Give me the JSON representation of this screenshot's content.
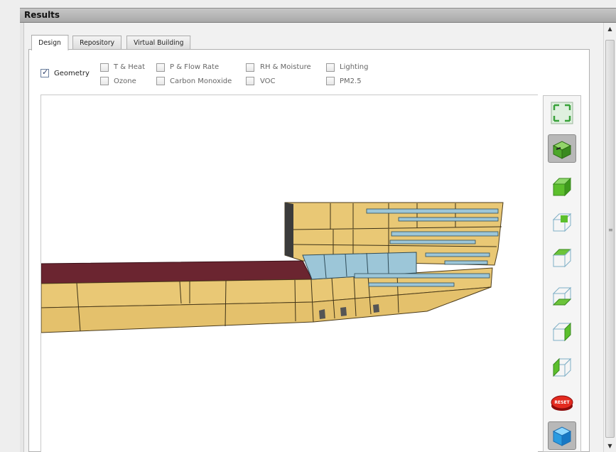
{
  "panel": {
    "title": "Results"
  },
  "tabs": [
    {
      "label": "Design",
      "active": true
    },
    {
      "label": "Repository",
      "active": false
    },
    {
      "label": "Virtual Building",
      "active": false
    }
  ],
  "layers": [
    {
      "label": "Geometry",
      "checked": true
    },
    {
      "label": "T & Heat",
      "checked": false
    },
    {
      "label": "P & Flow Rate",
      "checked": false
    },
    {
      "label": "RH & Moisture",
      "checked": false
    },
    {
      "label": "Lighting",
      "checked": false
    },
    {
      "label": "Ozone",
      "checked": false
    },
    {
      "label": "Carbon Monoxide",
      "checked": false
    },
    {
      "label": "VOC",
      "checked": false
    },
    {
      "label": "PM2.5",
      "checked": false
    }
  ],
  "toolbar": {
    "buttons": [
      {
        "icon": "fit-view-icon"
      },
      {
        "icon": "orbit-view-icon",
        "selected": true
      },
      {
        "icon": "iso-view-icon"
      },
      {
        "icon": "top-view-icon"
      },
      {
        "icon": "bottom-view-icon"
      },
      {
        "icon": "front-view-icon"
      },
      {
        "icon": "back-view-icon"
      },
      {
        "icon": "left-view-icon"
      },
      {
        "icon": "reset-button-icon",
        "label": "RESET"
      },
      {
        "icon": "solid-cube-icon"
      }
    ]
  },
  "colors": {
    "facade": "#e9c875",
    "roof": "#6b2530",
    "glass": "#9cc6d8",
    "view_icon_green": "#6cc43a"
  }
}
